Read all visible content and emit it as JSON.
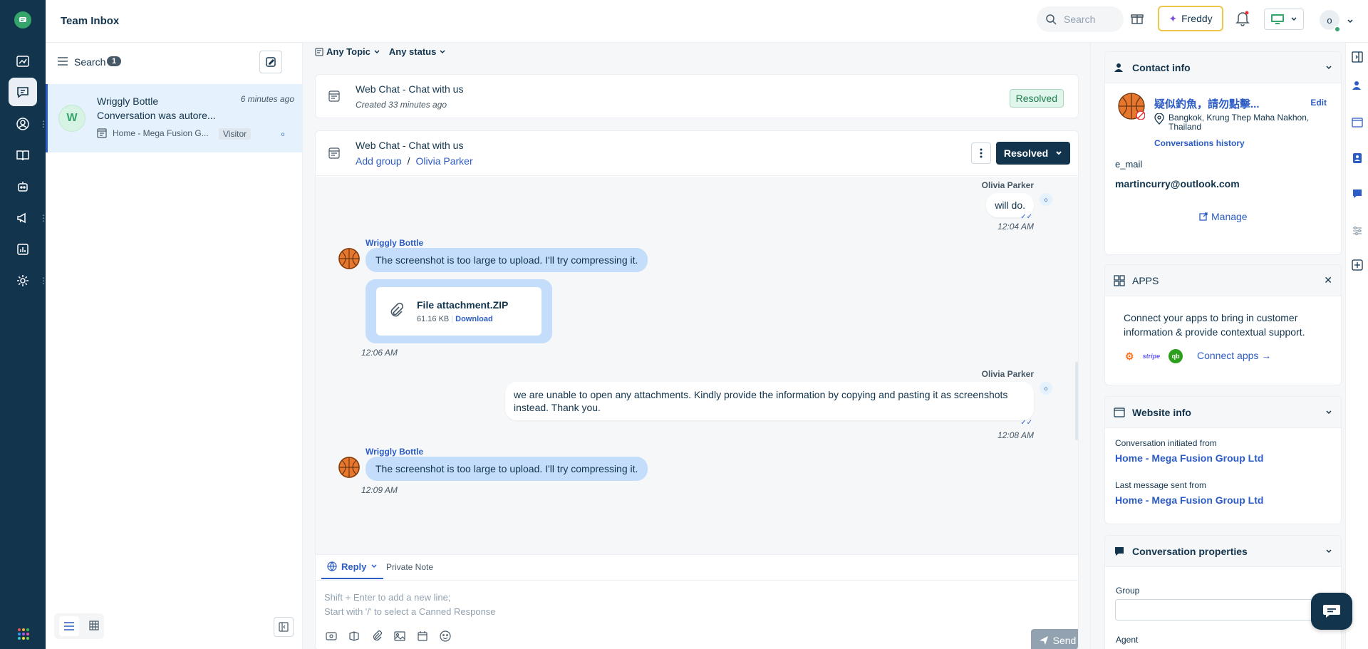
{
  "header": {
    "title": "Team Inbox",
    "search_placeholder": "Search",
    "freddy_label": "Freddy",
    "avatar_initial": "o"
  },
  "conv_list": {
    "search_label": "Search",
    "count": "1",
    "item": {
      "avatar_initial": "W",
      "name": "Wriggly Bottle",
      "time": "6 minutes ago",
      "preview": "Conversation was autore...",
      "source": "Home - Mega Fusion G...",
      "tag": "Visitor",
      "assignee_initial": "o"
    }
  },
  "filters": {
    "topic": "Any Topic",
    "status": "Any status"
  },
  "prev_conversation": {
    "title": "Web Chat - Chat with us",
    "created": "Created 33 minutes ago",
    "status": "Resolved"
  },
  "current_conversation": {
    "title": "Web Chat - Chat with us",
    "group_link": "Add group",
    "separator": "/",
    "agent_link": "Olivia Parker",
    "status_button": "Resolved"
  },
  "messages": [
    {
      "sender": "Olivia Parker",
      "text": "will do.",
      "time": "12:04 AM",
      "avatar_initial": "o"
    },
    {
      "sender": "Wriggly Bottle",
      "text": "The screenshot is too large to upload. I'll try compressing it."
    },
    {
      "attachment_name": "File attachment.ZIP",
      "attachment_size": "61.16 KB",
      "attachment_sep": "|",
      "attachment_link": "Download",
      "time": "12:06 AM"
    },
    {
      "sender": "Olivia Parker",
      "text": "we are unable to open any attachments. Kindly provide the information by copying and pasting it as screenshots instead. Thank you.",
      "time": "12:08 AM",
      "avatar_initial": "o"
    },
    {
      "sender": "Wriggly Bottle",
      "text": "The screenshot is too large to upload. I'll try compressing it.",
      "time": "12:09 AM"
    }
  ],
  "composer": {
    "reply_tab": "Reply",
    "note_tab": "Private Note",
    "placeholder_line1": "Shift + Enter to add a new line;",
    "placeholder_line2": "Start with '/' to select a Canned Response",
    "send_label": "Send"
  },
  "contact": {
    "section_title": "Contact info",
    "name": "疑似釣魚，請勿點擊...",
    "edit_label": "Edit",
    "location": "Bangkok, Krung Thep Maha Nakhon, Thailand",
    "history_link": "Conversations history",
    "email_label": "e_mail",
    "email_value": "martincurry@outlook.com",
    "manage_label": "Manage"
  },
  "apps": {
    "section_title": "APPS",
    "description": "Connect your apps to bring in customer information & provide contextual support.",
    "stripe_label": "stripe",
    "qb_label": "qb",
    "connect_label": "Connect apps →"
  },
  "website_info": {
    "section_title": "Website info",
    "initiated_label": "Conversation initiated from",
    "initiated_value": "Home - Mega Fusion Group Ltd",
    "last_label": "Last message sent from",
    "last_value": "Home - Mega Fusion Group Ltd"
  },
  "conv_properties": {
    "section_title": "Conversation properties",
    "group_label": "Group",
    "agent_label": "Agent"
  },
  "colors": {
    "nav_bg": "#12344d",
    "accent": "#2c5cc5",
    "incoming_bubble": "#c3ddfb",
    "resolved_green": "#1e7f4c",
    "freddy_border": "#f0c64a"
  }
}
